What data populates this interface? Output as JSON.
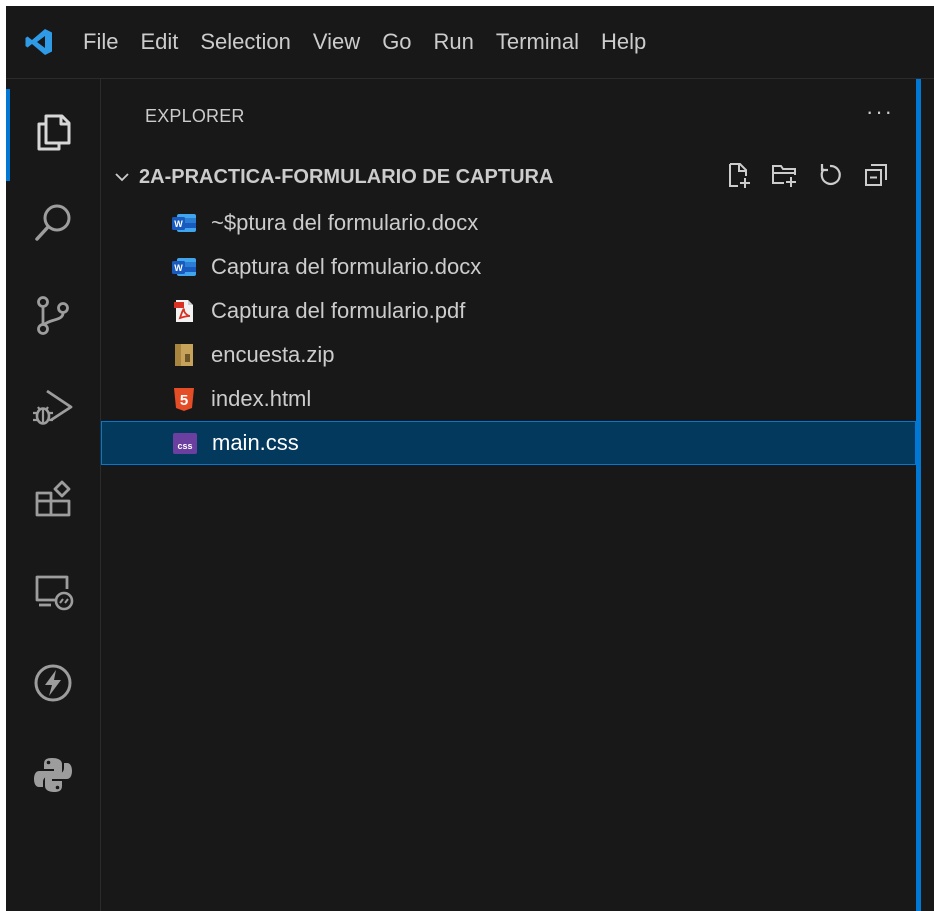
{
  "menubar": {
    "logo_icon": "vscode-logo-icon",
    "items": [
      "File",
      "Edit",
      "Selection",
      "View",
      "Go",
      "Run",
      "Terminal",
      "Help"
    ]
  },
  "activity_bar": {
    "items": [
      {
        "icon": "explorer-icon",
        "active": true
      },
      {
        "icon": "search-icon",
        "active": false
      },
      {
        "icon": "source-control-icon",
        "active": false
      },
      {
        "icon": "run-debug-icon",
        "active": false
      },
      {
        "icon": "extensions-icon",
        "active": false
      },
      {
        "icon": "remote-explorer-icon",
        "active": false
      },
      {
        "icon": "lightning-icon",
        "active": false
      },
      {
        "icon": "python-icon",
        "active": false
      }
    ]
  },
  "explorer": {
    "title": "EXPLORER",
    "more_label": "···",
    "folder": {
      "name": "2A-PRACTICA-FORMULARIO DE CAPTURA",
      "actions": [
        "new-file-icon",
        "new-folder-icon",
        "refresh-icon",
        "collapse-all-icon"
      ]
    },
    "files": [
      {
        "name": "~$ptura del formulario.docx",
        "icon": "word-icon",
        "selected": false
      },
      {
        "name": "Captura del formulario.docx",
        "icon": "word-icon",
        "selected": false
      },
      {
        "name": "Captura del formulario.pdf",
        "icon": "pdf-icon",
        "selected": false
      },
      {
        "name": "encuesta.zip",
        "icon": "zip-icon",
        "selected": false
      },
      {
        "name": "index.html",
        "icon": "html5-icon",
        "selected": false
      },
      {
        "name": "main.css",
        "icon": "css-icon",
        "selected": true
      }
    ]
  },
  "icon_labels": {
    "word": "W",
    "html": "5",
    "css": "css"
  },
  "colors": {
    "background": "#181818",
    "accent": "#0078d4",
    "selection": "#04395e",
    "text": "#cccccc",
    "word": "#185abd",
    "html": "#e44d26",
    "css": "#6b3fa0",
    "pdf": "#d93025",
    "zip": "#c7a25a",
    "vscode": "#2f9be6"
  }
}
